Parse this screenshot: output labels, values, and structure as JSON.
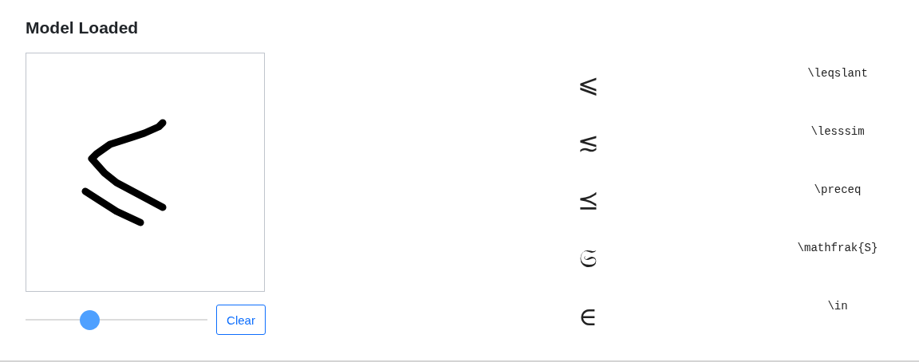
{
  "title": "Model Loaded",
  "brush_slider": {
    "level": 0.35
  },
  "clear_button": "Clear",
  "predictions": [
    {
      "symbol": "⩽",
      "latex": "\\leqslant"
    },
    {
      "symbol": "≲",
      "latex": "\\lesssim"
    },
    {
      "symbol": "⪯",
      "latex": "\\preceq"
    },
    {
      "symbol": "𝔖",
      "latex": "\\mathfrak{S}"
    },
    {
      "symbol": "∈",
      "latex": "\\in"
    }
  ]
}
